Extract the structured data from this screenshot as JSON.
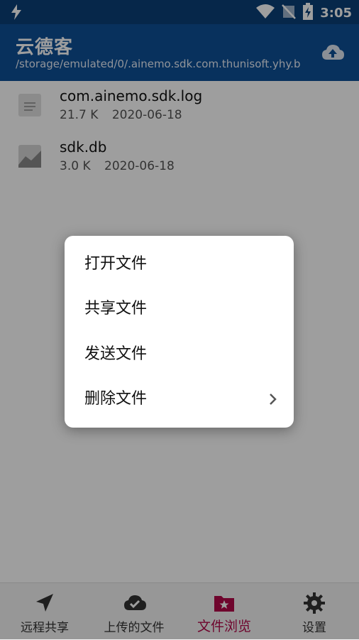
{
  "status": {
    "time": "3:05"
  },
  "app": {
    "title": "云德客",
    "path": "/storage/emulated/0/.ainemo.sdk.com.thunisoft.yhy.b"
  },
  "files": [
    {
      "name": "com.ainemo.sdk.log",
      "size": "21.7 K",
      "date": "2020-06-18",
      "icon": "document-icon"
    },
    {
      "name": "sdk.db",
      "size": "3.0 K",
      "date": "2020-06-18",
      "icon": "image-icon"
    }
  ],
  "dialog": {
    "items": [
      "打开文件",
      "共享文件",
      "发送文件",
      "删除文件"
    ]
  },
  "nav": {
    "tabs": [
      {
        "label": "远程共享",
        "icon": "navigation-arrow-icon"
      },
      {
        "label": "上传的文件",
        "icon": "cloud-check-icon"
      },
      {
        "label": "文件浏览",
        "icon": "folder-star-icon",
        "active": true
      },
      {
        "label": "设置",
        "icon": "gear-icon"
      }
    ]
  },
  "colors": {
    "appbar": "#0d4f97",
    "statusbar": "#0b3f78",
    "accent": "#b3094a"
  }
}
